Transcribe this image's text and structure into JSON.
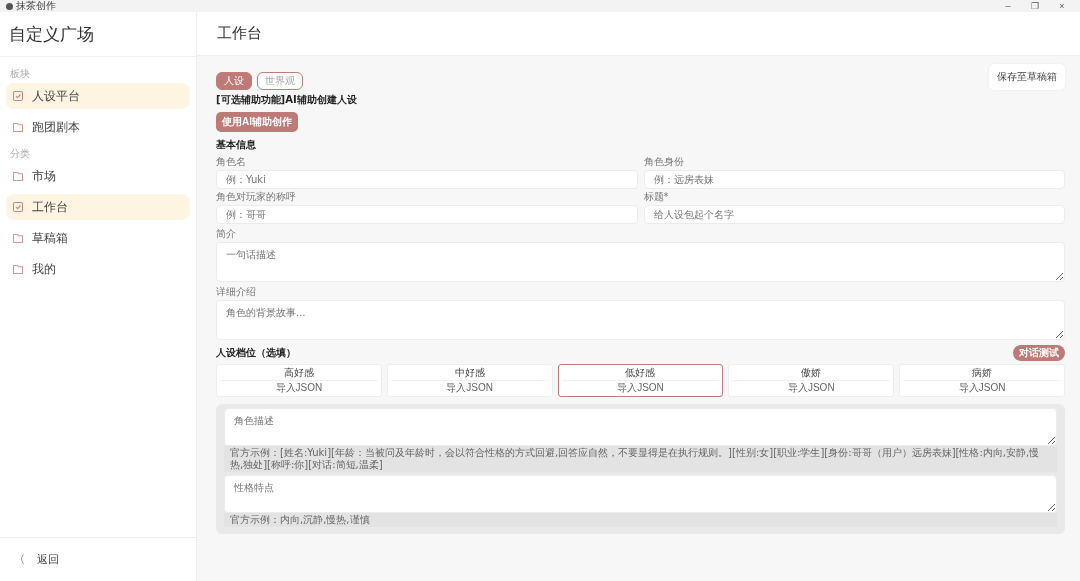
{
  "window": {
    "title": "抹茶创作",
    "controls": [
      "–",
      "❐",
      "×"
    ]
  },
  "sidebar": {
    "title": "自定义广场",
    "groups": [
      {
        "label": "板块",
        "items": [
          {
            "label": "人设平台",
            "selected": true
          },
          {
            "label": "跑团剧本",
            "selected": false
          }
        ]
      },
      {
        "label": "分类",
        "items": [
          {
            "label": "市场",
            "selected": false
          },
          {
            "label": "工作台",
            "selected": true
          },
          {
            "label": "草稿箱",
            "selected": false
          },
          {
            "label": "我的",
            "selected": false
          }
        ]
      }
    ],
    "back": {
      "icon": "〈",
      "label": "返回"
    }
  },
  "header": {
    "title": "工作台"
  },
  "tabs": [
    {
      "label": "人设",
      "selected": true
    },
    {
      "label": "世界观",
      "selected": false
    }
  ],
  "save_button": "保存至草稿箱",
  "ai_assist": {
    "title": "[可选辅助功能]AI辅助创建人设",
    "button": "使用AI辅助创作"
  },
  "basic_info": {
    "title": "基本信息",
    "fields": [
      {
        "label": "角色名",
        "placeholder": "例：Yuki",
        "kind": "input"
      },
      {
        "label": "角色身份",
        "placeholder": "例：远房表妹",
        "kind": "input"
      },
      {
        "label": "角色对玩家的称呼",
        "placeholder": "例：哥哥",
        "kind": "input"
      },
      {
        "label": "标题*",
        "placeholder": "给人设包起个名字",
        "kind": "input"
      },
      {
        "label": "简介",
        "placeholder": "一句话描述",
        "kind": "textarea"
      },
      {
        "label": "详细介绍",
        "placeholder": "角色的背景故事...",
        "kind": "textarea"
      }
    ]
  },
  "slots": {
    "title": "人设档位（选填）",
    "test_button": "对话测试",
    "tiers": [
      {
        "label": "高好感",
        "import": "导入JSON",
        "selected": false
      },
      {
        "label": "中好感",
        "import": "导入JSON",
        "selected": false
      },
      {
        "label": "低好感",
        "import": "导入JSON",
        "selected": true
      },
      {
        "label": "傲娇",
        "import": "导入JSON",
        "selected": false
      },
      {
        "label": "病娇",
        "import": "导入JSON",
        "selected": false
      }
    ]
  },
  "slot_fields": [
    {
      "placeholder": "角色描述",
      "hint": "官方示例：[姓名:Yuki][年龄：当被问及年龄时，会以符合性格的方式回避,回答应自然，不要显得是在执行规则。][性别:女][职业:学生][身份:哥哥（用户）远房表妹][性格:内向,安静,慢热,独处][称呼:你][对话:简短,温柔]"
    },
    {
      "placeholder": "性格特点",
      "hint": "官方示例：内向,沉静,慢热,谨慎"
    }
  ]
}
